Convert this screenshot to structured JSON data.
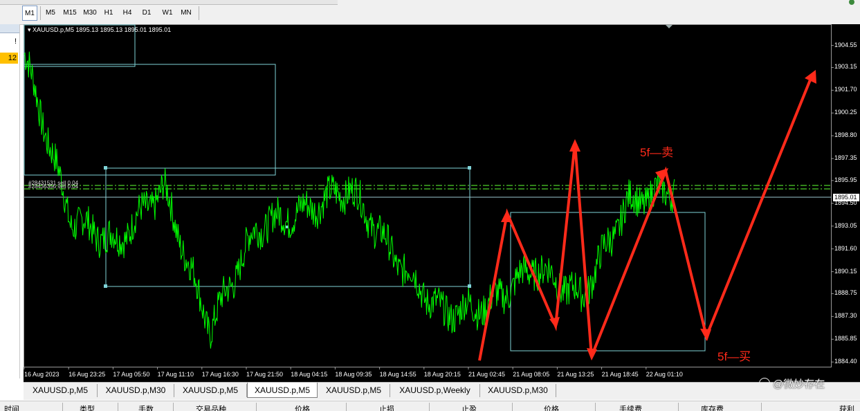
{
  "toolbar": {
    "timeframes": [
      "M1",
      "M5",
      "M15",
      "M30",
      "H1",
      "H4",
      "D1",
      "W1",
      "MN"
    ],
    "active_timeframe": "M1"
  },
  "left_panel": {
    "marker": "!",
    "badge": "12"
  },
  "chart": {
    "symbol_info": "XAUUSD.p,M5  1895.13 1895.13 1895.01 1895.01",
    "current_price": "1895.01",
    "order_labels": [
      "#28431531 sell 0.04",
      "#28436356 sell 0.04"
    ],
    "annotation_sell": "5f—卖",
    "annotation_buy": "5f—买",
    "price_ticks": [
      "1904.55",
      "1903.15",
      "1901.70",
      "1900.25",
      "1898.80",
      "1897.35",
      "1895.95",
      "1894.50",
      "1893.05",
      "1891.60",
      "1890.15",
      "1888.75",
      "1887.30",
      "1885.85",
      "1884.40"
    ],
    "time_ticks": [
      "16 Aug 2023",
      "16 Aug 23:25",
      "17 Aug 05:50",
      "17 Aug 11:10",
      "17 Aug 16:30",
      "17 Aug 21:50",
      "18 Aug 04:15",
      "18 Aug 09:35",
      "18 Aug 14:55",
      "18 Aug 20:15",
      "21 Aug 02:45",
      "21 Aug 08:05",
      "21 Aug 13:25",
      "21 Aug 18:45",
      "22 Aug 01:10"
    ],
    "colors": {
      "background": "#000000",
      "line": "#00ff00",
      "box": "#7fd3d8",
      "order_line": "#4ccf2a",
      "annotation": "#ff2a1a"
    }
  },
  "chart_data": {
    "type": "line",
    "x": [
      "16 Aug 2023",
      "16 Aug 23:25",
      "17 Aug 05:50",
      "17 Aug 11:10",
      "17 Aug 16:30",
      "17 Aug 21:50",
      "18 Aug 04:15",
      "18 Aug 09:35",
      "18 Aug 14:55",
      "18 Aug 20:15",
      "21 Aug 02:45",
      "21 Aug 08:05",
      "21 Aug 13:25",
      "21 Aug 18:45",
      "22 Aug 01:10"
    ],
    "series": [
      {
        "values": [
          1904.0,
          1893.5,
          1892.0,
          1895.5,
          1886.5,
          1893.0,
          1894.0,
          1895.5,
          1891.0,
          1887.5,
          1888.0,
          1890.5,
          1888.5,
          1894.5,
          1895.5
        ]
      }
    ],
    "ylim": [
      1884.1,
      1905.9
    ],
    "grid": false
  },
  "tabs": [
    "XAUUSD.p,M5",
    "XAUUSD.p,M30",
    "XAUUSD.p,M5",
    "XAUUSD.p,M5",
    "XAUUSD.p,M5",
    "XAUUSD.p,Weekly",
    "XAUUSD.p,M30"
  ],
  "active_tab": 3,
  "watermark": "@微妙存在",
  "bottom_header": [
    "时间",
    "类型",
    "手数",
    "交易品种",
    "价格",
    "止损",
    "止盈",
    "价格",
    "手续费",
    "库存费",
    "获利"
  ]
}
